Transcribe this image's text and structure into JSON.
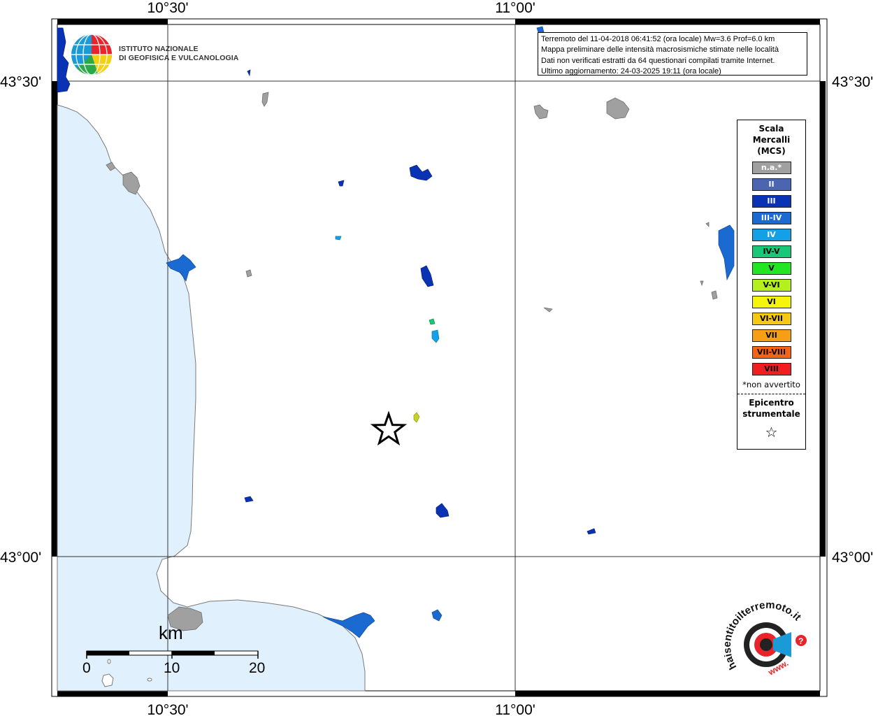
{
  "logo": {
    "line1": "ISTITUTO NAZIONALE",
    "line2": "DI GEOFISICA E VULCANOLOGIA"
  },
  "info": {
    "line1": "Terremoto del 11-04-2018 06:41:52 (ora locale) Mw=3.6 Prof=6.0 km",
    "line2": "Mappa preliminare delle intensità macrosismiche stimate nelle località",
    "line3": "Dati non verificati estratti da 64 questionari compilati tramite Internet.",
    "line4": "Ultimo aggiornamento: 24-03-2025 19:11 (ora locale)"
  },
  "coords": {
    "lon_1030": "10°30'",
    "lon_1100": "11°00'",
    "lat_4330": "43°30'",
    "lat_4300": "43°00'"
  },
  "legend": {
    "title1": "Scala",
    "title2": "Mercalli",
    "title3": "(MCS)",
    "items": [
      {
        "label": "n.a.*",
        "color": "#a0a0a0",
        "text_color": "#ffffff"
      },
      {
        "label": "II",
        "color": "#4a66b0",
        "text_color": "#ffffff"
      },
      {
        "label": "III",
        "color": "#0a32b4",
        "text_color": "#ffffff"
      },
      {
        "label": "III-IV",
        "color": "#1a6ad2",
        "text_color": "#ffffff"
      },
      {
        "label": "IV",
        "color": "#14a0e6",
        "text_color": "#ffffff"
      },
      {
        "label": "IV-V",
        "color": "#18c878",
        "text_color": "#000000"
      },
      {
        "label": "V",
        "color": "#22e622",
        "text_color": "#000000"
      },
      {
        "label": "V-VI",
        "color": "#b4f01e",
        "text_color": "#000000"
      },
      {
        "label": "VI",
        "color": "#f5f50a",
        "text_color": "#000000"
      },
      {
        "label": "VI-VII",
        "color": "#f5c814",
        "text_color": "#000000"
      },
      {
        "label": "VII",
        "color": "#f5a014",
        "text_color": "#000000"
      },
      {
        "label": "VII-VIII",
        "color": "#f56414",
        "text_color": "#000000"
      },
      {
        "label": "VIII",
        "color": "#f01e1e",
        "text_color": "#000000"
      }
    ],
    "note": "*non avvertito",
    "epicentre1": "Epicentro",
    "epicentre2": "strumentale",
    "star": "☆"
  },
  "scale": {
    "unit": "km",
    "ticks": [
      "0",
      "10",
      "20"
    ]
  },
  "badge": {
    "text": "haisentitoilterremoto.it",
    "www": "www."
  },
  "colors": {
    "sea": "#e0f0fc",
    "coast": "#7a7a7a",
    "na": "#a0a0a0",
    "int_III": "#0a32b4",
    "int_IIIIV": "#1a6ad2",
    "int_IV": "#14a0e6",
    "int_IVV": "#18c878",
    "int_VVI": "#b4f01e"
  }
}
